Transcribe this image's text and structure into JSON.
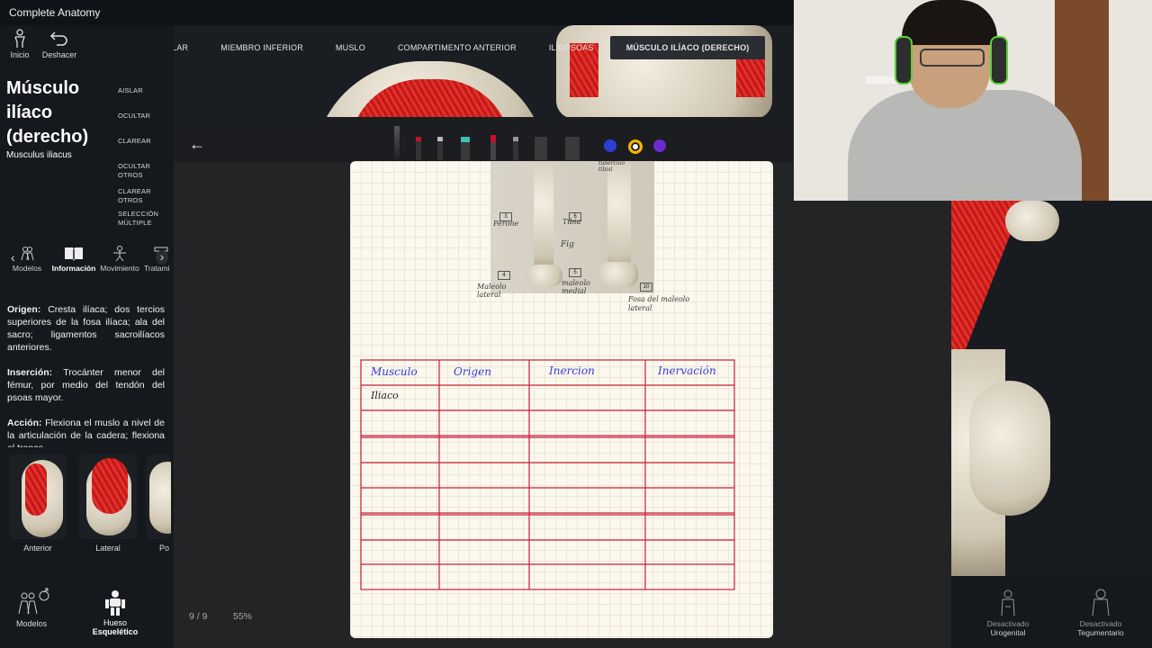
{
  "app": {
    "title": "Complete Anatomy"
  },
  "nav": {
    "home_label": "Inicio",
    "undo_label": "Deshacer"
  },
  "breadcrumb": [
    "SISTEMA MUSCULAR",
    "MIEMBRO INFERIOR",
    "MUSLO",
    "COMPARTIMENTO ANTERIOR",
    "ILIOPSOAS",
    "MÚSCULO ILÍACO (DERECHO)"
  ],
  "structure": {
    "title_lines": [
      "Músculo",
      "ilíaco",
      "(derecho)"
    ],
    "latin": "Musculus iliacus"
  },
  "side_menu": {
    "isolate": "AISLAR",
    "hide": "OCULTAR",
    "fade": "CLAREAR",
    "hide_others": "OCULTAR OTROS",
    "fade_others": "CLAREAR OTROS",
    "multi_select_1": "SELECCIÓN",
    "multi_select_2": "MÚLTIPLE"
  },
  "tabs": {
    "models": "Modelos",
    "info": "Información",
    "movement": "Movimiento",
    "treatment": "Tratami"
  },
  "info": {
    "origin_label": "Origen:",
    "origin_text": " Cresta ilíaca; dos tercios superiores de la fosa ilíaca; ala del sacro; ligamentos sacroilíacos anteriores.",
    "insertion_label": "Inserción:",
    "insertion_text": " Trocánter menor del fémur, por medio del tendón del psoas mayor.",
    "action_label": "Acción:",
    "action_text": " Flexiona el muslo a nivel de la articulación de la cadera; flexiona el tronco"
  },
  "views": {
    "anterior": "Anterior",
    "lateral": "Lateral",
    "posterior": "Po"
  },
  "bottom_left": {
    "models": "Modelos",
    "skeletal_1": "Hueso",
    "skeletal_2": "Esquelético"
  },
  "notes": {
    "page_indicator": "9 / 9",
    "zoom": "55%",
    "swatch_colors": [
      "#2a3fd6",
      "#ffffff",
      "#6a2bd1"
    ],
    "sketch_labels": {
      "peroneo": "Perone",
      "tibia": "Tibia",
      "maleolo_lateral": "Maleolo lateral",
      "maleolo_medial": "maleolo medial",
      "fosa": "Fosa del maleolo lateral",
      "sup": "tubérculo",
      "sup2": "tibial",
      "num_3": "3",
      "num_6": "6",
      "num_4": "4",
      "num_5": "5",
      "num_10": "10",
      "fig": "Fig"
    },
    "table_headers": [
      "Musculo",
      "Origen",
      "Inercion",
      "Inervación"
    ],
    "table_first_cell": "Iliaco"
  },
  "right_bottom": {
    "urogenital_state": "Desactivado",
    "urogenital": "Urogenital",
    "integumentary_state": "Desactivado",
    "integumentary": "Tegumentario"
  },
  "colors": {
    "pen_red": "#c8102e",
    "table_red": "#c81f3a",
    "ink_blue": "#3b3be0"
  }
}
